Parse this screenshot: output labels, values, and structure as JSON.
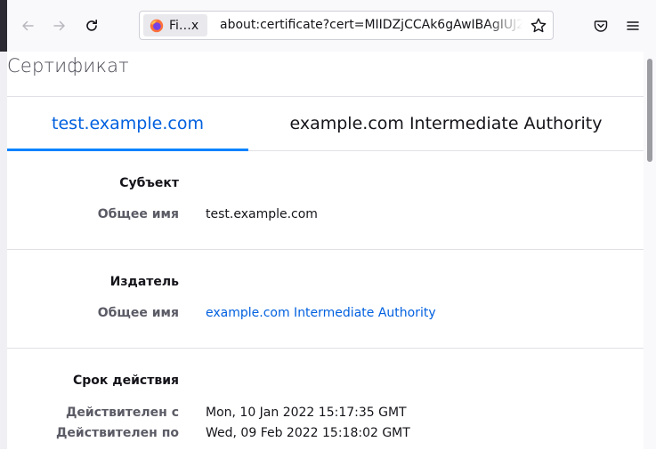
{
  "browser": {
    "identity_label": "Fi…x",
    "url": "about:certificate?cert=MIIDZjCCAk6gAwIBAgIUJ2",
    "icons": [
      "back-arrow-icon",
      "forward-arrow-icon",
      "reload-icon",
      "firefox-logo-icon",
      "bookmark-star-icon",
      "pocket-icon",
      "hamburger-menu-icon"
    ]
  },
  "page": {
    "title": "Сертификат",
    "tabs": [
      {
        "label": "test.example.com",
        "active": true
      },
      {
        "label": "example.com Intermediate Authority",
        "active": false
      }
    ],
    "subject": {
      "heading": "Субъект",
      "common_name_label": "Общее имя",
      "common_name_value": "test.example.com"
    },
    "issuer": {
      "heading": "Издатель",
      "common_name_label": "Общее имя",
      "common_name_value": "example.com Intermediate Authority"
    },
    "validity": {
      "heading": "Срок действия",
      "not_before_label": "Действителен с",
      "not_before_value": "Mon, 10 Jan 2022 15:17:35 GMT",
      "not_after_label": "Действителен по",
      "not_after_value": "Wed, 09 Feb 2022 15:18:02 GMT"
    }
  },
  "colors": {
    "accent": "#0060df",
    "tab_underline": "#0a84ff",
    "toolbar_bg": "#f9f9fb"
  }
}
